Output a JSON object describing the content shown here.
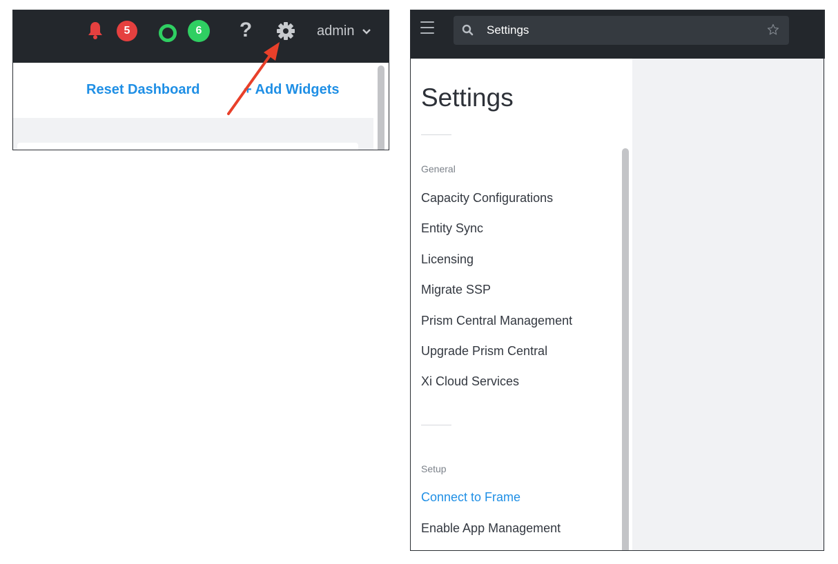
{
  "dashboard": {
    "alerts_count": "5",
    "tasks_count": "6",
    "help_label": "?",
    "user_label": "admin",
    "reset_dashboard_label": "Reset Dashboard",
    "add_widgets_label": "+ Add Widgets",
    "icons": [
      "bell-icon",
      "task-ring-icon",
      "gear-icon",
      "chevron-down-icon"
    ],
    "colors": {
      "alert": "#e5403f",
      "task": "#2fcf62",
      "arrow": "#e8402a",
      "link": "#1f8fe5"
    }
  },
  "settings_page": {
    "search": {
      "value": "Settings"
    },
    "title": "Settings",
    "sections": [
      {
        "label": "General",
        "items": [
          "Capacity Configurations",
          "Entity Sync",
          "Licensing",
          "Migrate SSP",
          "Prism Central Management",
          "Upgrade Prism Central",
          "Xi Cloud Services"
        ]
      },
      {
        "label": "Setup",
        "items": [
          "Connect to Frame",
          "Enable App Management"
        ]
      }
    ],
    "active_item": "Connect to Frame",
    "icons": [
      "hamburger-menu-icon",
      "search-icon",
      "star-icon"
    ]
  }
}
